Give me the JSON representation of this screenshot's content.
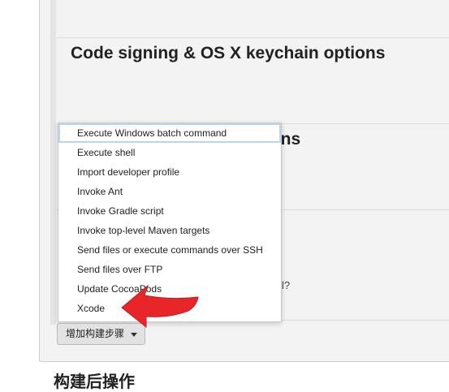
{
  "sections": {
    "code_signing_title": "Code signing & OS X keychain options",
    "partial_title_suffix": "tions",
    "partial_question": "l?",
    "post_build_title": "构建后操作"
  },
  "menu": {
    "items": [
      {
        "label": "Execute Windows batch command"
      },
      {
        "label": "Execute shell"
      },
      {
        "label": "Import developer profile"
      },
      {
        "label": "Invoke Ant"
      },
      {
        "label": "Invoke Gradle script"
      },
      {
        "label": "Invoke top-level Maven targets"
      },
      {
        "label": "Send files or execute commands over SSH"
      },
      {
        "label": "Send files over FTP"
      },
      {
        "label": "Update CocoaPods"
      },
      {
        "label": "Xcode"
      }
    ]
  },
  "add_step_button": {
    "label": "增加构建步骤"
  },
  "icons": {
    "caret": "chevron-down-icon",
    "arrow": "red-arrow-icon"
  },
  "colors": {
    "arrow": "#e8262a",
    "panel": "#f3f3f3"
  }
}
